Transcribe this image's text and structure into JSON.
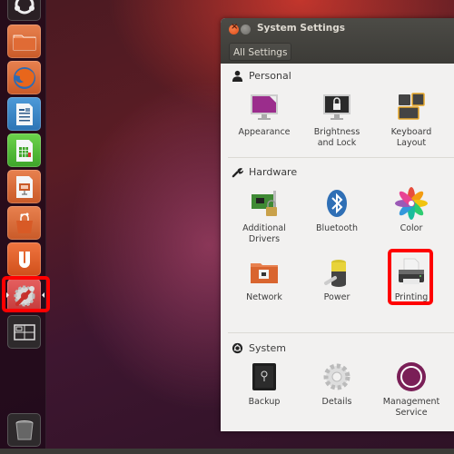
{
  "launcher": {
    "items": [
      {
        "name": "dash-home",
        "label": "Dash Home"
      },
      {
        "name": "files",
        "label": "Home Folder"
      },
      {
        "name": "firefox",
        "label": "Firefox Web Browser"
      },
      {
        "name": "writer",
        "label": "LibreOffice Writer"
      },
      {
        "name": "calc",
        "label": "LibreOffice Calc"
      },
      {
        "name": "impress",
        "label": "LibreOffice Impress"
      },
      {
        "name": "software-center",
        "label": "Ubuntu Software Center"
      },
      {
        "name": "ubuntu-one",
        "label": "Ubuntu One"
      },
      {
        "name": "system-settings",
        "label": "System Settings",
        "active": true,
        "highlighted": true
      },
      {
        "name": "workspace-switcher",
        "label": "Workspace Switcher"
      },
      {
        "name": "trash",
        "label": "Trash"
      }
    ]
  },
  "window": {
    "title": "System Settings",
    "all_settings_label": "All Settings",
    "sections": [
      {
        "title": "Personal",
        "icon": "person-icon",
        "items": [
          {
            "label_line1": "Appearance",
            "label_line2": ""
          },
          {
            "label_line1": "Brightness",
            "label_line2": "and Lock"
          },
          {
            "label_line1": "Keyboard",
            "label_line2": "Layout"
          }
        ]
      },
      {
        "title": "Hardware",
        "icon": "wrench-icon",
        "items": [
          {
            "label_line1": "Additional",
            "label_line2": "Drivers"
          },
          {
            "label_line1": "Bluetooth",
            "label_line2": ""
          },
          {
            "label_line1": "Color",
            "label_line2": ""
          },
          {
            "label_line1": "Network",
            "label_line2": ""
          },
          {
            "label_line1": "Power",
            "label_line2": ""
          },
          {
            "label_line1": "Printing",
            "label_line2": "",
            "highlighted": true
          }
        ]
      },
      {
        "title": "System",
        "icon": "ubuntu-logo-icon",
        "items": [
          {
            "label_line1": "Backup",
            "label_line2": ""
          },
          {
            "label_line1": "Details",
            "label_line2": ""
          },
          {
            "label_line1": "Management",
            "label_line2": "Service"
          }
        ]
      }
    ]
  },
  "colors": {
    "highlight": "#ff0000",
    "titlebar": "#3c3b37",
    "window_bg": "#f2f1f0",
    "close_button": "#df4a16"
  }
}
